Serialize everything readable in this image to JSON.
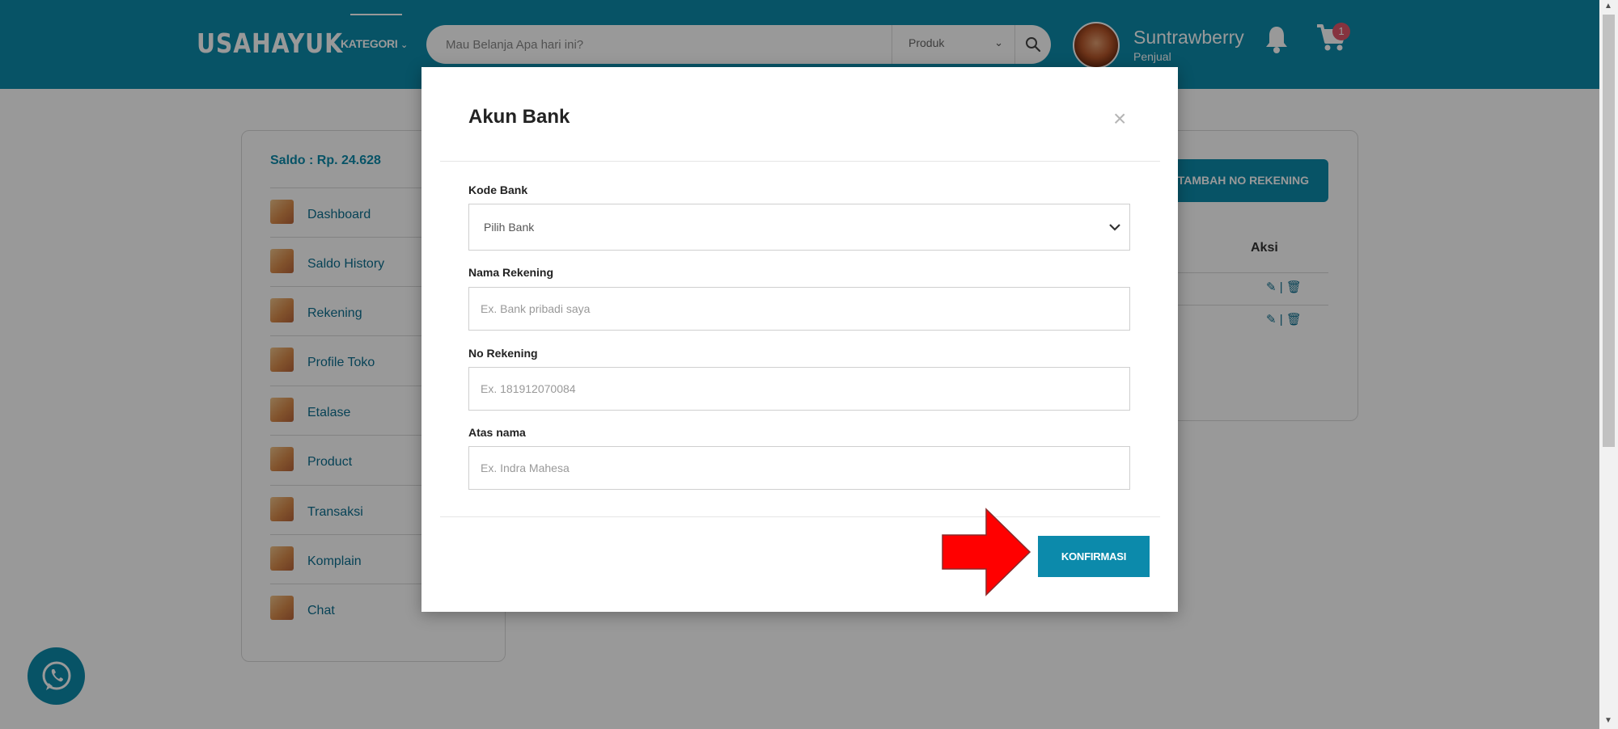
{
  "header": {
    "logo": "USAHAYUK",
    "kategori_label": "KATEGORI",
    "search_placeholder": "Mau Belanja Apa hari ini?",
    "search_category": "Produk",
    "username": "Suntrawberry",
    "role": "Penjual",
    "cart_count": "1"
  },
  "sidebar": {
    "saldo": "Saldo : Rp. 24.628",
    "items": [
      {
        "label": "Dashboard"
      },
      {
        "label": "Saldo History"
      },
      {
        "label": "Rekening"
      },
      {
        "label": "Profile Toko"
      },
      {
        "label": "Etalase"
      },
      {
        "label": "Product"
      },
      {
        "label": "Transaksi"
      },
      {
        "label": "Komplain"
      },
      {
        "label": "Chat"
      }
    ]
  },
  "content": {
    "add_button": "TAMBAH NO REKENING",
    "aksi_header": "Aksi"
  },
  "modal": {
    "title": "Akun Bank",
    "close": "×",
    "kode_bank_label": "Kode Bank",
    "kode_bank_value": "Pilih Bank",
    "nama_rekening_label": "Nama Rekening",
    "nama_rekening_placeholder": "Ex. Bank pribadi saya",
    "no_rekening_label": "No Rekening",
    "no_rekening_placeholder": "Ex. 181912070084",
    "atas_nama_label": "Atas nama",
    "atas_nama_placeholder": "Ex. Indra Mahesa",
    "confirm_button": "KONFIRMASI"
  },
  "colors": {
    "primary": "#0c8aab",
    "annotation_arrow": "#ff0000"
  }
}
